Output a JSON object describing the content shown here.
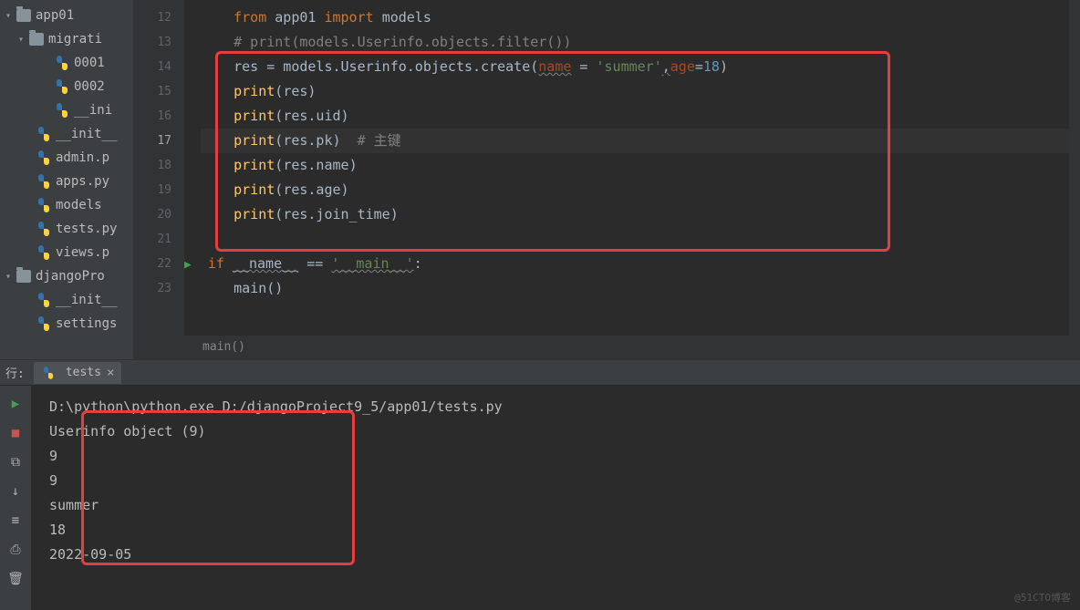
{
  "sidebar": {
    "items": [
      {
        "label": "app01",
        "icon": "folder",
        "indent": 0,
        "chevron": "▾"
      },
      {
        "label": "migrati",
        "icon": "folder",
        "indent": 1,
        "chevron": "▾"
      },
      {
        "label": "0001",
        "icon": "py",
        "indent": 3
      },
      {
        "label": "0002",
        "icon": "py",
        "indent": 3
      },
      {
        "label": "__ini",
        "icon": "py",
        "indent": 3
      },
      {
        "label": "__init__",
        "icon": "py",
        "indent": 2
      },
      {
        "label": "admin.p",
        "icon": "py",
        "indent": 2
      },
      {
        "label": "apps.py",
        "icon": "py",
        "indent": 2
      },
      {
        "label": "models",
        "icon": "py",
        "indent": 2
      },
      {
        "label": "tests.py",
        "icon": "py",
        "indent": 2
      },
      {
        "label": "views.p",
        "icon": "py",
        "indent": 2
      },
      {
        "label": "djangoPro",
        "icon": "folder",
        "indent": 0,
        "chevron": "▾"
      },
      {
        "label": "__init__",
        "icon": "py",
        "indent": 2
      },
      {
        "label": "settings",
        "icon": "py",
        "indent": 2
      }
    ]
  },
  "editor": {
    "line_numbers": [
      12,
      13,
      14,
      15,
      16,
      17,
      18,
      19,
      20,
      21,
      22,
      23
    ],
    "current_line": 17,
    "run_marker_line": 22,
    "code": {
      "l12": {
        "from": "from",
        "mod": "app01",
        "import": "import",
        "name": "models"
      },
      "l13": {
        "comment": "# print(models.Userinfo.objects.filter())"
      },
      "l14": {
        "lhs": "res = models.Userinfo.objects.create(",
        "p1": "name",
        "eq1": " = ",
        "s1": "'summer'",
        "comma": ",",
        "p2": "age",
        "eq2": "=",
        "n2": "18",
        "rp": ")"
      },
      "l15": {
        "fn": "print",
        "arg": "res"
      },
      "l16": {
        "fn": "print",
        "arg": "res.uid"
      },
      "l17": {
        "fn": "print",
        "arg": "res.pk",
        "comment": "  # 主键"
      },
      "l18": {
        "fn": "print",
        "arg": "res.name"
      },
      "l19": {
        "fn": "print",
        "arg": "res.age"
      },
      "l20": {
        "fn": "print",
        "arg": "res.join_time"
      },
      "l22": {
        "if": "if",
        "name": "__name__",
        "eq": " == ",
        "str": "'__main__'",
        "colon": ":"
      },
      "l23": {
        "fn": "main",
        "args": "()"
      }
    },
    "breadcrumb": "main()"
  },
  "run_panel": {
    "label": "行:",
    "tab_name": "tests",
    "output": [
      "D:\\python\\python.exe D:/djangoProject9_5/app01/tests.py",
      "Userinfo object (9)",
      "9",
      "9",
      "summer",
      "18",
      "2022-09-05"
    ]
  },
  "watermark": "@51CTO博客"
}
